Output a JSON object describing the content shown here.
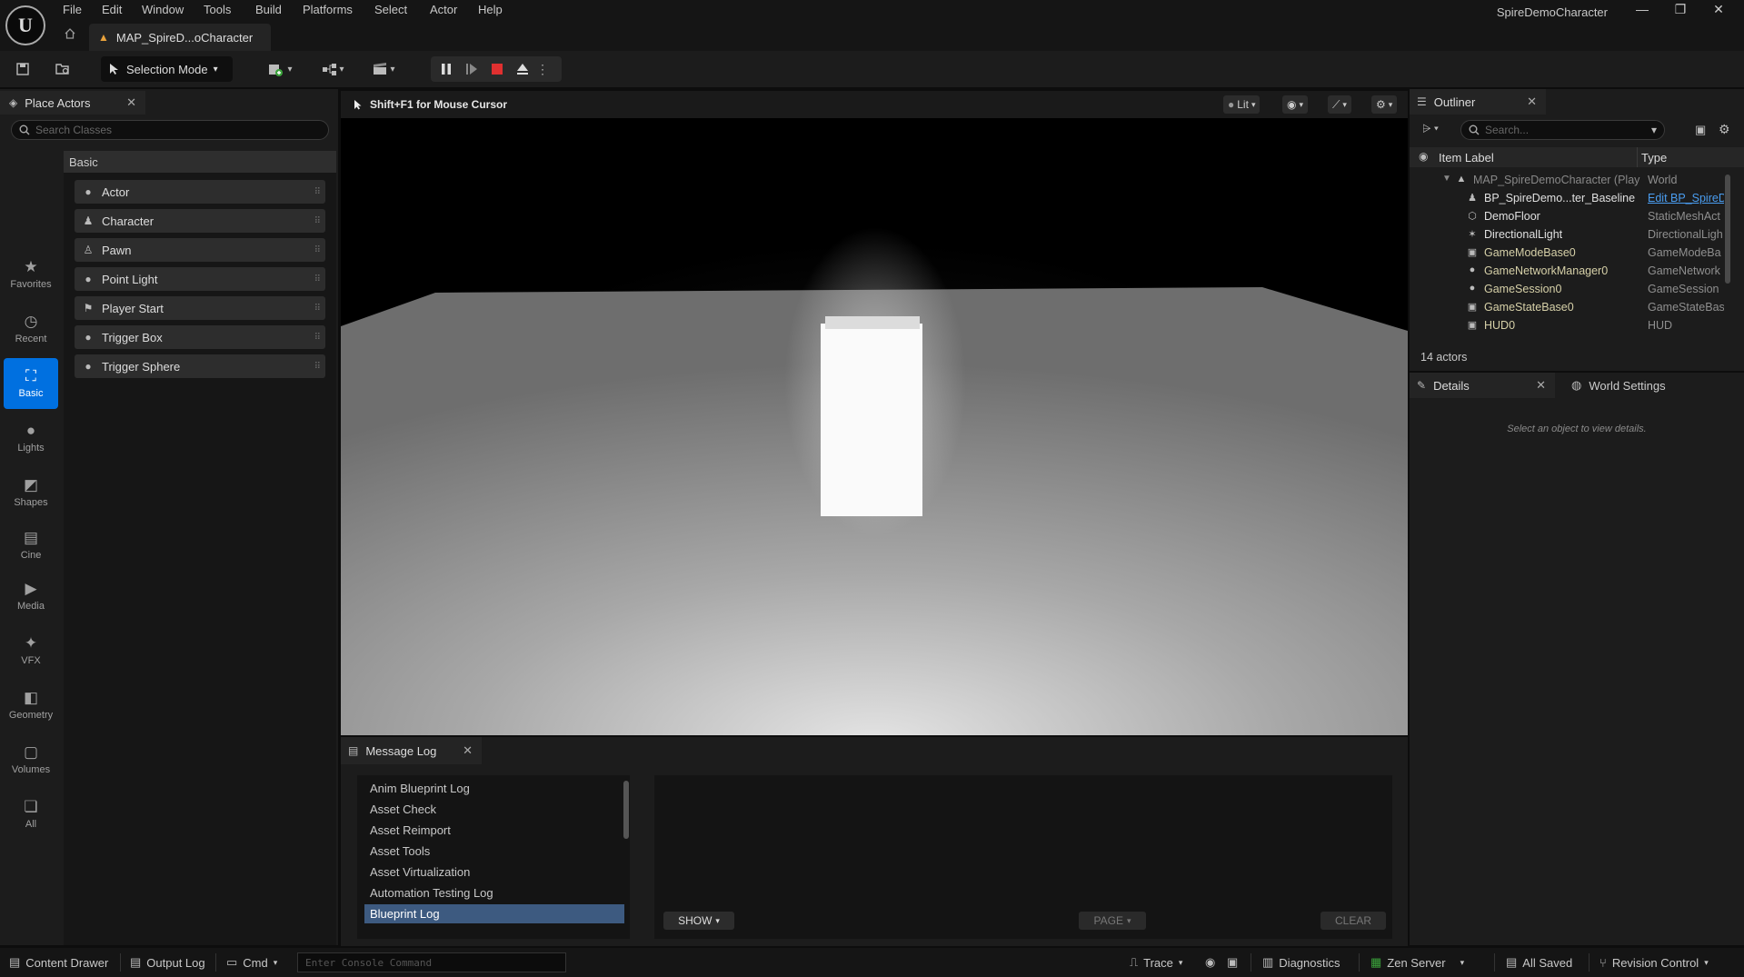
{
  "app": {
    "window_title": "SpireDemoCharacter",
    "doc_tab": "MAP_SpireD...oCharacter",
    "logo_text": "U"
  },
  "menu": [
    "File",
    "Edit",
    "Window",
    "Tools",
    "Build",
    "Platforms",
    "Select",
    "Actor",
    "Help"
  ],
  "toolbar": {
    "selection_mode": "Selection Mode"
  },
  "place_actors": {
    "tab": "Place Actors",
    "search_placeholder": "Search Classes",
    "categories": [
      {
        "label": "Favorites",
        "icon": "star-icon"
      },
      {
        "label": "Recent",
        "icon": "clock-icon"
      },
      {
        "label": "Basic",
        "icon": "basic-icon"
      },
      {
        "label": "Lights",
        "icon": "bulb-icon"
      },
      {
        "label": "Shapes",
        "icon": "shapes-icon"
      },
      {
        "label": "Cine",
        "icon": "clapper-icon"
      },
      {
        "label": "Media",
        "icon": "media-icon"
      },
      {
        "label": "VFX",
        "icon": "sparkle-icon"
      },
      {
        "label": "Geometry",
        "icon": "geometry-icon"
      },
      {
        "label": "Volumes",
        "icon": "volume-icon"
      },
      {
        "label": "All",
        "icon": "all-icon"
      }
    ],
    "active_category": "Basic",
    "section": "Basic",
    "items": [
      "Actor",
      "Character",
      "Pawn",
      "Point Light",
      "Player Start",
      "Trigger Box",
      "Trigger Sphere"
    ]
  },
  "viewport": {
    "hint": "Shift+F1 for Mouse Cursor",
    "lit_label": "Lit"
  },
  "message_log": {
    "tab": "Message Log",
    "categories": [
      "Anim Blueprint Log",
      "Asset Check",
      "Asset Reimport",
      "Asset Tools",
      "Asset Virtualization",
      "Automation Testing Log",
      "Blueprint Log"
    ],
    "selected": "Blueprint Log",
    "show": "SHOW",
    "page": "PAGE",
    "clear": "CLEAR"
  },
  "outliner": {
    "tab": "Outliner",
    "search_placeholder": "Search...",
    "col_label": "Item Label",
    "col_type": "Type",
    "rows": [
      {
        "label": "MAP_SpireDemoCharacter (Play",
        "type": "World"
      },
      {
        "label": "BP_SpireDemo...ter_Baseline",
        "type": "Edit BP_SpireD"
      },
      {
        "label": "DemoFloor",
        "type": "StaticMeshAct"
      },
      {
        "label": "DirectionalLight",
        "type": "DirectionalLigh"
      },
      {
        "label": "GameModeBase0",
        "type": "GameModeBa"
      },
      {
        "label": "GameNetworkManager0",
        "type": "GameNetwork"
      },
      {
        "label": "GameSession0",
        "type": "GameSession"
      },
      {
        "label": "GameStateBase0",
        "type": "GameStateBas"
      },
      {
        "label": "HUD0",
        "type": "HUD"
      }
    ],
    "count": "14 actors"
  },
  "details": {
    "tab": "Details",
    "world_tab": "World Settings",
    "empty": "Select an object to view details."
  },
  "statusbar": {
    "content_drawer": "Content Drawer",
    "output_log": "Output Log",
    "cmd": "Cmd",
    "console_placeholder": "Enter Console Command",
    "trace": "Trace",
    "diagnostics": "Diagnostics",
    "zen": "Zen Server",
    "saved": "All Saved",
    "revision": "Revision Control"
  },
  "colors": {
    "accent": "#0070e0",
    "selection": "#3d5a80",
    "stop": "#e03030",
    "link": "#4a9df0"
  }
}
